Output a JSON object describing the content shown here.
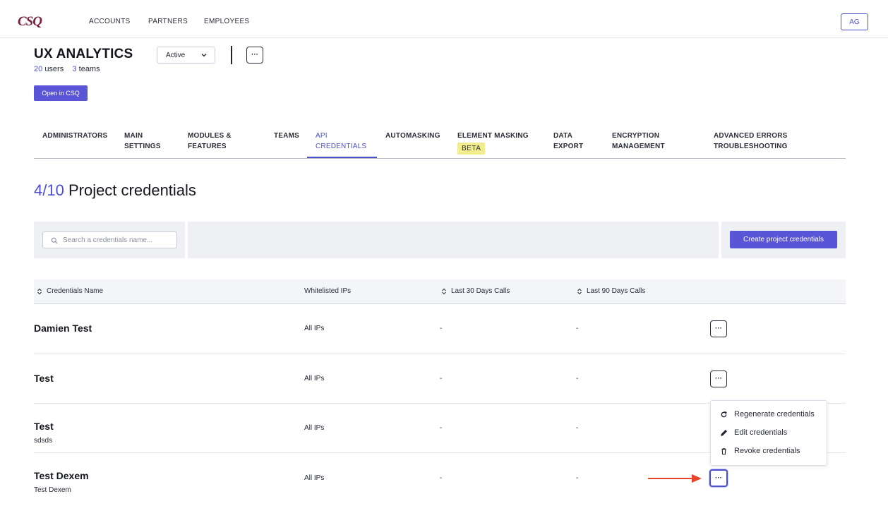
{
  "nav": {
    "logo": "CSQ",
    "links": [
      "ACCOUNTS",
      "PARTNERS",
      "EMPLOYEES"
    ],
    "avatar": "AG"
  },
  "header": {
    "title": "UX ANALYTICS",
    "users_count": "20",
    "users_label": "users",
    "teams_count": "3",
    "teams_label": "teams",
    "status": "Active",
    "open_button": "Open in CSQ"
  },
  "tabs": [
    {
      "label": "ADMINISTRATORS"
    },
    {
      "label": "MAIN\nSETTINGS"
    },
    {
      "label": "MODULES &\nFEATURES"
    },
    {
      "label": "TEAMS"
    },
    {
      "label": "API\nCREDENTIALS"
    },
    {
      "label": "AUTOMASKING"
    },
    {
      "label": "ELEMENT MASKING",
      "badge": "BETA"
    },
    {
      "label": "DATA\nEXPORT"
    },
    {
      "label": "ENCRYPTION\nMANAGEMENT"
    },
    {
      "label": "ADVANCED ERRORS\nTROUBLESHOOTING"
    }
  ],
  "section": {
    "count": "4/10",
    "title": "Project credentials"
  },
  "toolbar": {
    "search_placeholder": "Search a credentials name...",
    "create_button": "Create project credentials"
  },
  "table": {
    "columns": [
      "Credentials Name",
      "Whitelisted IPs",
      "Last 30 Days Calls",
      "Last 90 Days Calls"
    ],
    "rows": [
      {
        "name": "Damien Test",
        "description": "",
        "ips": "All IPs",
        "calls30": "-",
        "calls90": "-"
      },
      {
        "name": "Test",
        "description": "",
        "ips": "All IPs",
        "calls30": "-",
        "calls90": "-"
      },
      {
        "name": "Test",
        "description": "sdsds",
        "ips": "All IPs",
        "calls30": "-",
        "calls90": "-"
      },
      {
        "name": "Test Dexem",
        "description": "Test Dexem",
        "ips": "All IPs",
        "calls30": "-",
        "calls90": "-"
      }
    ]
  },
  "menu": {
    "items": [
      "Regenerate credentials",
      "Edit credentials",
      "Revoke credentials"
    ]
  },
  "colors": {
    "accent": "#4b4fcf",
    "button": "#5a55d6",
    "logo": "#7a1e3a",
    "badge": "#f3ec8e",
    "annotation_arrow": "#e8442a"
  },
  "more_label": "···"
}
